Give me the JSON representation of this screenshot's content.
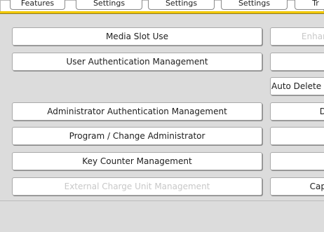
{
  "tabs": [
    "Features",
    "Settings",
    "Settings",
    "Settings",
    "Tr"
  ],
  "left_buttons": [
    {
      "label": "Media Slot Use",
      "enabled": true
    },
    {
      "label": "User Authentication Management",
      "enabled": true
    },
    {
      "label": "Administrator Authentication Management",
      "enabled": true
    },
    {
      "label": "Program / Change Administrator",
      "enabled": true
    },
    {
      "label": "Key Counter Management",
      "enabled": true
    },
    {
      "label": "External Charge Unit Management",
      "enabled": false
    }
  ],
  "right_buttons": [
    {
      "label": "Enhar",
      "enabled": false
    },
    {
      "label": "",
      "enabled": true
    },
    {
      "label": "Auto Delete",
      "enabled": true
    },
    {
      "label": "D",
      "enabled": true
    },
    {
      "label": "",
      "enabled": true
    },
    {
      "label": "",
      "enabled": true
    },
    {
      "label": "Cap",
      "enabled": true
    }
  ],
  "colors": {
    "accent": "#f1c800",
    "panel": "#dcdcdc",
    "disabled_text": "#c8c8c8"
  }
}
